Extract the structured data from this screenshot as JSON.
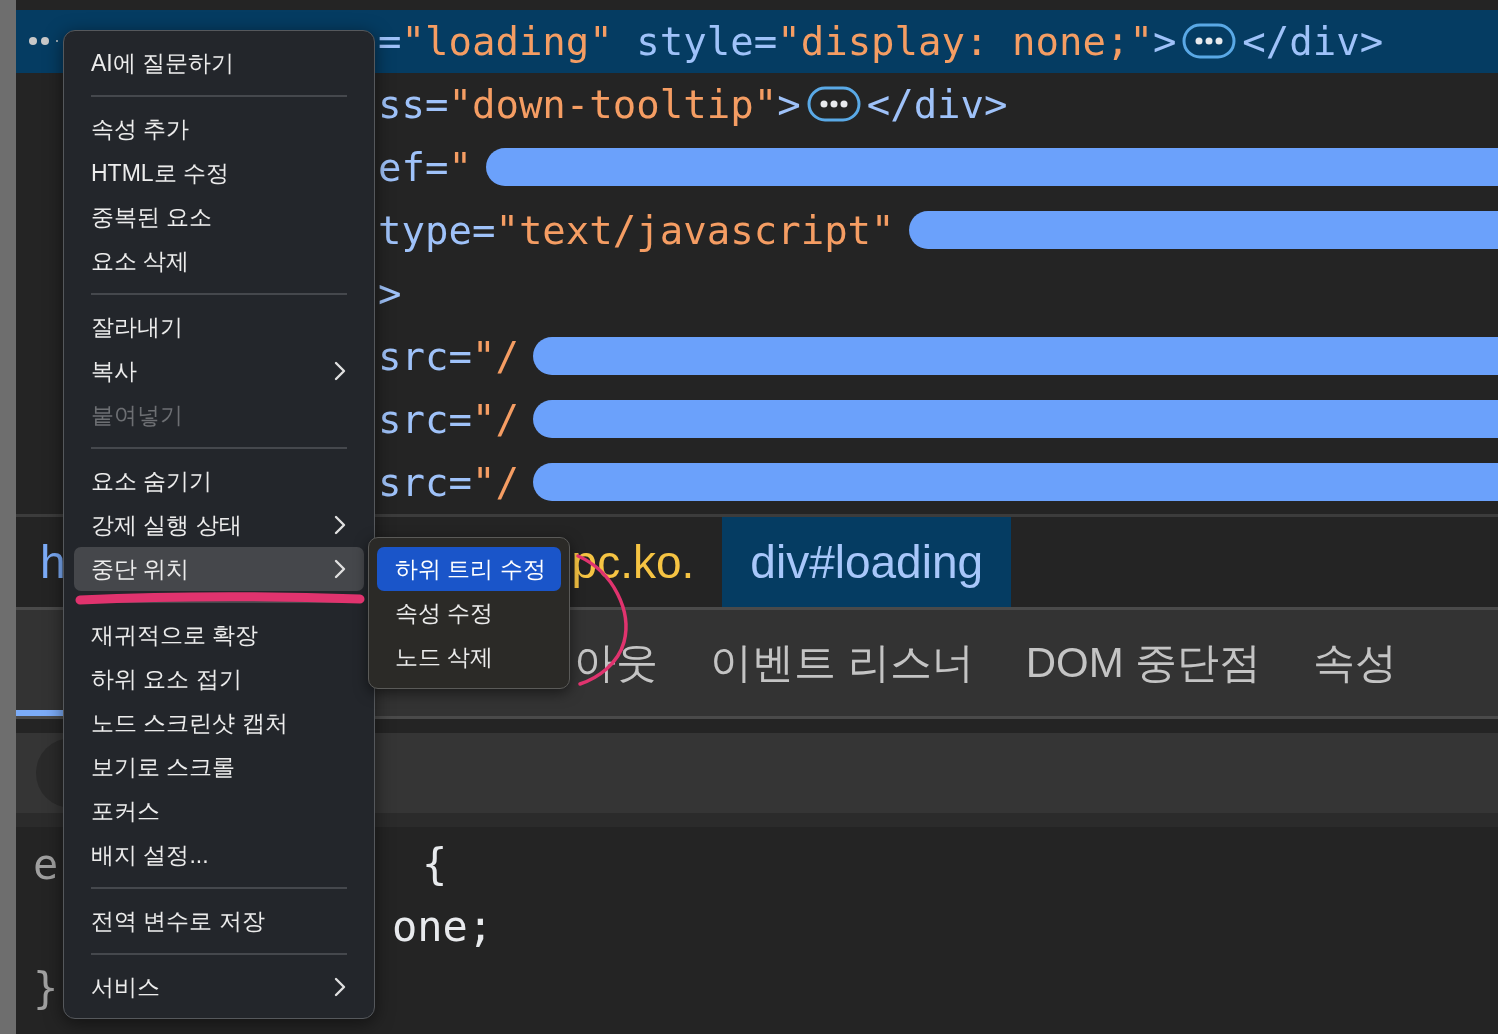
{
  "elements_tree": {
    "rows": [
      {
        "selected": true,
        "parts": [
          {
            "kind": "name",
            "text": "="
          },
          {
            "kind": "value",
            "text": "\"loading\""
          },
          {
            "kind": "name",
            "text": " style="
          },
          {
            "kind": "value",
            "text": "\"display: none;\""
          },
          {
            "kind": "name",
            "text": ">"
          },
          {
            "kind": "ellipsis"
          },
          {
            "kind": "name",
            "text": "</div>"
          }
        ]
      },
      {
        "selected": false,
        "parts": [
          {
            "kind": "name",
            "text": "ss="
          },
          {
            "kind": "value",
            "text": "\"down-tooltip\""
          },
          {
            "kind": "name",
            "text": ">"
          },
          {
            "kind": "ellipsis"
          },
          {
            "kind": "name",
            "text": "</div>"
          }
        ]
      },
      {
        "selected": false,
        "parts": [
          {
            "kind": "name",
            "text": "ef="
          },
          {
            "kind": "value",
            "text": "\""
          },
          {
            "kind": "redacted"
          }
        ]
      },
      {
        "selected": false,
        "parts": [
          {
            "kind": "name",
            "text": "type="
          },
          {
            "kind": "value",
            "text": "\"text/javascript\""
          },
          {
            "kind": "redacted"
          }
        ]
      },
      {
        "selected": false,
        "parts": [
          {
            "kind": "name",
            "text": ">"
          }
        ]
      },
      {
        "selected": false,
        "parts": [
          {
            "kind": "name",
            "text": "src="
          },
          {
            "kind": "value",
            "text": "\"/"
          },
          {
            "kind": "redacted"
          }
        ]
      },
      {
        "selected": false,
        "parts": [
          {
            "kind": "name",
            "text": "src="
          },
          {
            "kind": "value",
            "text": "\"/"
          },
          {
            "kind": "redacted"
          }
        ]
      },
      {
        "selected": false,
        "parts": [
          {
            "kind": "name",
            "text": "src="
          },
          {
            "kind": "value",
            "text": "\"/"
          },
          {
            "kind": "redacted"
          }
        ]
      }
    ]
  },
  "breadcrumbs": [
    {
      "text": "h",
      "kind": "tag",
      "selected": false
    },
    {
      "text": "pc.ko.",
      "kind": "class",
      "selected": false
    },
    {
      "text": "div#loading",
      "kind": "tag",
      "selected": true
    }
  ],
  "tabs": [
    {
      "label": "아웃",
      "selected": false
    },
    {
      "label": "이벤트 리스너",
      "selected": false
    },
    {
      "label": "DOM 중단점",
      "selected": false
    },
    {
      "label": "속성",
      "selected": false
    }
  ],
  "styles_pane": {
    "lines": [
      {
        "left_text": "e",
        "right_text": "{"
      },
      {
        "right_text": "one;"
      },
      {
        "left_text": "}"
      }
    ]
  },
  "context_menu": {
    "sections": [
      [
        {
          "label": "AI에 질문하기",
          "submenu": false,
          "disabled": false,
          "selected": false
        }
      ],
      [
        {
          "label": "속성 추가",
          "submenu": false,
          "disabled": false,
          "selected": false
        },
        {
          "label": "HTML로 수정",
          "submenu": false,
          "disabled": false,
          "selected": false
        },
        {
          "label": "중복된 요소",
          "submenu": false,
          "disabled": false,
          "selected": false
        },
        {
          "label": "요소 삭제",
          "submenu": false,
          "disabled": false,
          "selected": false
        }
      ],
      [
        {
          "label": "잘라내기",
          "submenu": false,
          "disabled": false,
          "selected": false
        },
        {
          "label": "복사",
          "submenu": true,
          "disabled": false,
          "selected": false
        },
        {
          "label": "붙여넣기",
          "submenu": false,
          "disabled": true,
          "selected": false
        }
      ],
      [
        {
          "label": "요소 숨기기",
          "submenu": false,
          "disabled": false,
          "selected": false
        },
        {
          "label": "강제 실행 상태",
          "submenu": true,
          "disabled": false,
          "selected": false
        },
        {
          "label": "중단 위치",
          "submenu": true,
          "disabled": false,
          "selected": true
        }
      ],
      [
        {
          "label": "재귀적으로 확장",
          "submenu": false,
          "disabled": false,
          "selected": false
        },
        {
          "label": "하위 요소 접기",
          "submenu": false,
          "disabled": false,
          "selected": false
        },
        {
          "label": "노드 스크린샷 캡처",
          "submenu": false,
          "disabled": false,
          "selected": false
        },
        {
          "label": "보기로 스크롤",
          "submenu": false,
          "disabled": false,
          "selected": false
        },
        {
          "label": "포커스",
          "submenu": false,
          "disabled": false,
          "selected": false
        },
        {
          "label": "배지 설정...",
          "submenu": false,
          "disabled": false,
          "selected": false
        }
      ],
      [
        {
          "label": "전역 변수로 저장",
          "submenu": false,
          "disabled": false,
          "selected": false
        }
      ],
      [
        {
          "label": "서비스",
          "submenu": true,
          "disabled": false,
          "selected": false
        }
      ]
    ]
  },
  "submenu": {
    "items": [
      {
        "label": "하위 트리 수정",
        "selected": true
      },
      {
        "label": "속성 수정",
        "selected": false
      },
      {
        "label": "노드 삭제",
        "selected": false
      }
    ]
  }
}
